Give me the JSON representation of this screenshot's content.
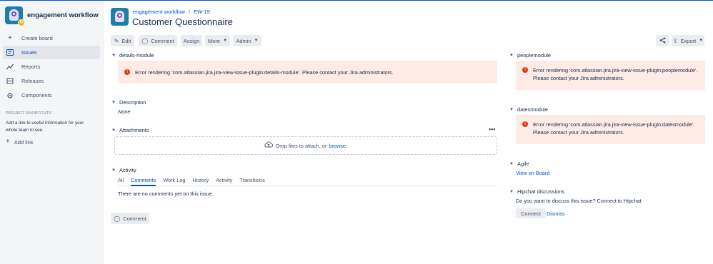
{
  "sidebar": {
    "project_name": "engagement workflow",
    "items": [
      {
        "label": "Create board",
        "icon": "plus-icon"
      },
      {
        "label": "Issues",
        "icon": "issues-icon"
      },
      {
        "label": "Reports",
        "icon": "reports-icon"
      },
      {
        "label": "Releases",
        "icon": "releases-icon"
      },
      {
        "label": "Components",
        "icon": "components-icon"
      }
    ],
    "shortcuts_title": "PROJECT SHORTCUTS",
    "shortcuts_desc": "Add a link to useful information for your whole team to see.",
    "add_link": "Add link"
  },
  "header": {
    "breadcrumb_project": "engagement workflow",
    "breadcrumb_sep": "/",
    "breadcrumb_issue": "EW-19",
    "title": "Customer Questionnaire"
  },
  "toolbar": {
    "edit": "Edit",
    "comment": "Comment",
    "assign": "Assign",
    "more": "More",
    "admin": "Admin",
    "export": "Export"
  },
  "modules": {
    "details": {
      "title": "details-module",
      "error": "Error rendering 'com.atlassian.jira.jira-view-issue-plugin:details-module'. Please contact your Jira administrators."
    },
    "description": {
      "title": "Description",
      "value": "None"
    },
    "attachments": {
      "title": "Attachments",
      "drop_text": "Drop files to attach, or",
      "browse": "browse."
    },
    "activity": {
      "title": "Activity",
      "tabs": [
        "All",
        "Comments",
        "Work Log",
        "History",
        "Activity",
        "Transitions"
      ],
      "active_tab": "Comments",
      "empty": "There are no comments yet on this issue."
    },
    "comment_button": "Comment",
    "people": {
      "title": "peoplemodule",
      "error_line1": "Error rendering 'com.atlassian.jira.jira-view-issue-plugin:peoplemodule'.",
      "error_line2": "Please contact your Jira administrators."
    },
    "dates": {
      "title": "datesmodule",
      "error_line1": "Error rendering 'com.atlassian.jira.jira-view-issue-plugin:datesmodule'.",
      "error_line2": "Please contact your Jira administrators."
    },
    "agile": {
      "title": "Agile",
      "link": "View on Board"
    },
    "hipchat": {
      "title": "Hipchat discussions",
      "text": "Do you want to discuss this issue? Connect to Hipchat.",
      "connect": "Connect",
      "dismiss": "Dismiss"
    }
  },
  "colors": {
    "accent": "#0052CC",
    "error_bg": "#FFEBE6",
    "error_icon": "#DE350B",
    "sidebar_bg": "#F4F5F7"
  }
}
